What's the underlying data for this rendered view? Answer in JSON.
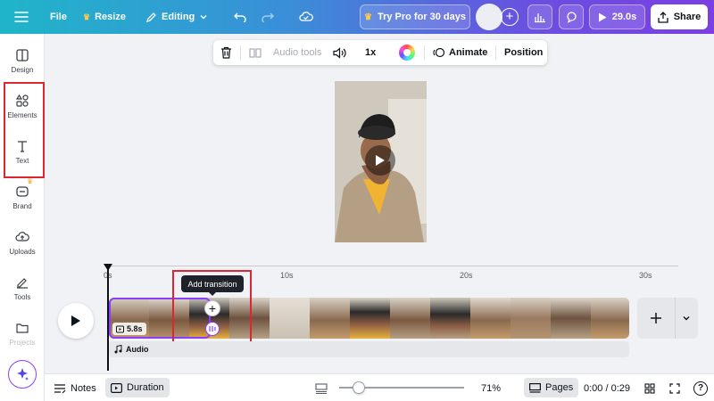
{
  "topbar": {
    "menu_icon": "hamburger-icon",
    "file": "File",
    "resize": "Resize",
    "editing": "Editing",
    "try_pro": "Try Pro for 30 days",
    "timer": "29.0s",
    "share": "Share"
  },
  "sidebar": {
    "items": [
      {
        "label": "Design",
        "icon": "layout-icon"
      },
      {
        "label": "Elements",
        "icon": "shapes-icon"
      },
      {
        "label": "Text",
        "icon": "text-icon"
      },
      {
        "label": "Brand",
        "icon": "brand-icon"
      },
      {
        "label": "Uploads",
        "icon": "cloud-upload-icon"
      },
      {
        "label": "Tools",
        "icon": "pen-tools-icon"
      },
      {
        "label": "Projects",
        "icon": "folder-icon"
      }
    ]
  },
  "context_toolbar": {
    "audio_tools": "Audio tools",
    "speed": "1x",
    "animate": "Animate",
    "position": "Position"
  },
  "timeline": {
    "ruler": [
      "0s",
      "10s",
      "20s",
      "30s"
    ],
    "clip_duration": "5.8s",
    "tooltip": "Add transition",
    "audio_label": "Audio"
  },
  "bottombar": {
    "notes": "Notes",
    "duration": "Duration",
    "zoom": "71%",
    "pages": "Pages",
    "time": "0:00 / 0:29",
    "help": "?"
  },
  "colors": {
    "accent": "#8b3dff",
    "highlight": "#e0252e"
  }
}
